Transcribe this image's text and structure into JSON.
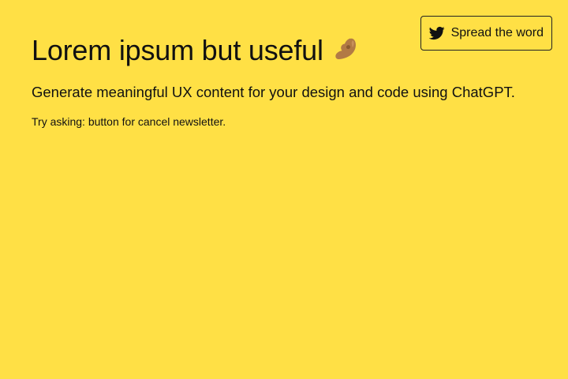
{
  "header": {
    "share_button_label": "Spread the word",
    "share_icon": "twitter-icon"
  },
  "main": {
    "title": "Lorem ipsum but useful",
    "title_icon": "pinching-hand-icon",
    "subtitle": "Generate meaningful UX content for your design and code using ChatGPT.",
    "hint": "Try asking: button for cancel newsletter."
  },
  "colors": {
    "background": "#ffe045",
    "text": "#111111",
    "border": "#222222",
    "icon_skin": "#b27a45"
  }
}
